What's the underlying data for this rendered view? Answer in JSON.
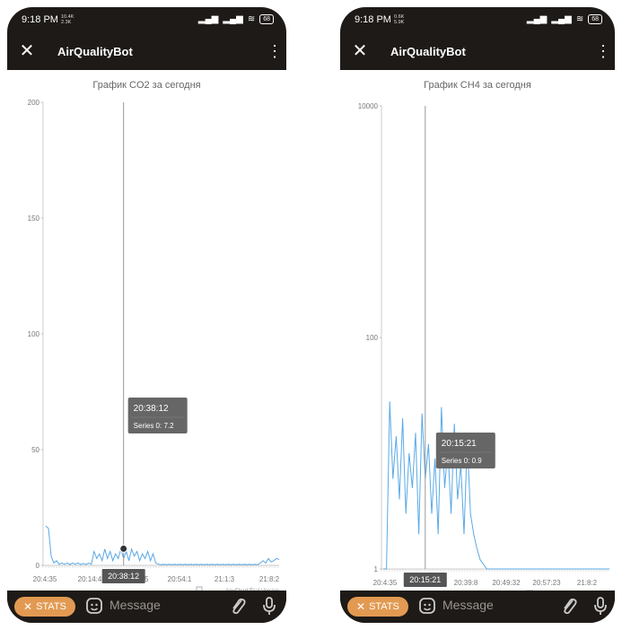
{
  "phones": [
    {
      "status": {
        "time": "9:18 PM",
        "net_speed_top": "10.4K",
        "net_speed_bottom": "2.3K",
        "battery": "68"
      },
      "app": {
        "title": "AirQualityBot"
      },
      "chart_data": {
        "type": "line",
        "title": "График CO2 за сегодня",
        "y_ticks": [
          "200",
          "150",
          "100",
          "50",
          "0"
        ],
        "x_ticks": [
          "20:4:35",
          "20:14:4",
          "20:49:15",
          "20:54:1",
          "21:1:3",
          "21:8:2"
        ],
        "ylim": [
          0,
          200
        ],
        "series": [
          {
            "color": "#5aa9e6",
            "values": [
              17,
              16,
              4,
              1,
              2,
              0.5,
              1,
              0.5,
              1,
              0.4,
              1,
              0.5,
              1,
              0.4,
              0.8,
              0.4,
              1,
              0.5,
              6,
              3,
              5,
              2,
              7,
              3,
              6,
              2,
              5,
              3,
              7,
              3,
              6,
              2,
              7,
              4,
              6,
              2,
              5,
              3,
              6,
              2,
              5,
              1,
              0.5,
              0.3,
              0.5,
              0.3,
              0.5,
              0.3,
              0.5,
              0.3,
              0.5,
              0.3,
              0.5,
              0.3,
              0.5,
              0.3,
              0.5,
              0.3,
              0.5,
              0.3,
              0.5,
              0.3,
              0.5,
              0.3,
              0.5,
              0.3,
              0.5,
              0.3,
              0.5,
              0.3,
              0.5,
              0.3,
              0.5,
              0.3,
              0.5,
              0.3,
              0.5,
              0.3,
              0.5,
              0.3,
              1,
              2,
              1,
              3,
              1.5,
              2,
              3,
              2.5
            ]
          }
        ],
        "crosshair": {
          "x_label": "20:38:12",
          "tooltip_time": "20:38:12",
          "tooltip_series": "Series 0: 7.2",
          "marker_value": 7.2,
          "marker_index": 29
        },
        "credit": "AnyChart Trial Version"
      },
      "bottom": {
        "stats": "STATS",
        "message": "Message"
      }
    },
    {
      "status": {
        "time": "9:18 PM",
        "net_speed_top": "0.6K",
        "net_speed_bottom": "5.9K",
        "battery": "68"
      },
      "app": {
        "title": "AirQualityBot"
      },
      "chart_data": {
        "type": "line",
        "log_scale": true,
        "title": "График CH4 за сегодня",
        "y_ticks": [
          "10000",
          "100",
          "1"
        ],
        "x_ticks": [
          "20:4:35",
          "20:15:21",
          "20:39:8",
          "20:49:32",
          "20:57:23",
          "21:8:2"
        ],
        "ylim": [
          1,
          10000
        ],
        "series": [
          {
            "color": "#5aa9e6",
            "values": [
              1,
              1,
              28,
              6,
              14,
              4,
              20,
              3,
              10,
              5,
              15,
              2,
              22,
              6,
              12,
              3,
              9,
              2,
              25,
              5,
              11,
              3,
              18,
              4,
              8,
              2,
              13,
              3,
              2,
              1.5,
              1.2,
              1.1,
              1,
              1,
              1,
              1,
              1,
              1,
              1,
              1,
              1,
              1,
              1,
              1,
              1,
              1,
              1,
              1,
              1,
              1,
              1,
              1,
              1,
              1,
              1,
              1,
              1,
              1,
              1,
              1,
              1,
              1,
              1,
              1,
              1,
              1,
              1,
              1,
              1,
              1,
              1
            ]
          }
        ],
        "crosshair": {
          "x_label": "20:15:21",
          "tooltip_time": "20:15:21",
          "tooltip_series": "Series 0: 0.9",
          "marker_index": 13
        },
        "credit": "AnyChart Trial Version"
      },
      "bottom": {
        "stats": "STATS",
        "message": "Message"
      }
    }
  ]
}
